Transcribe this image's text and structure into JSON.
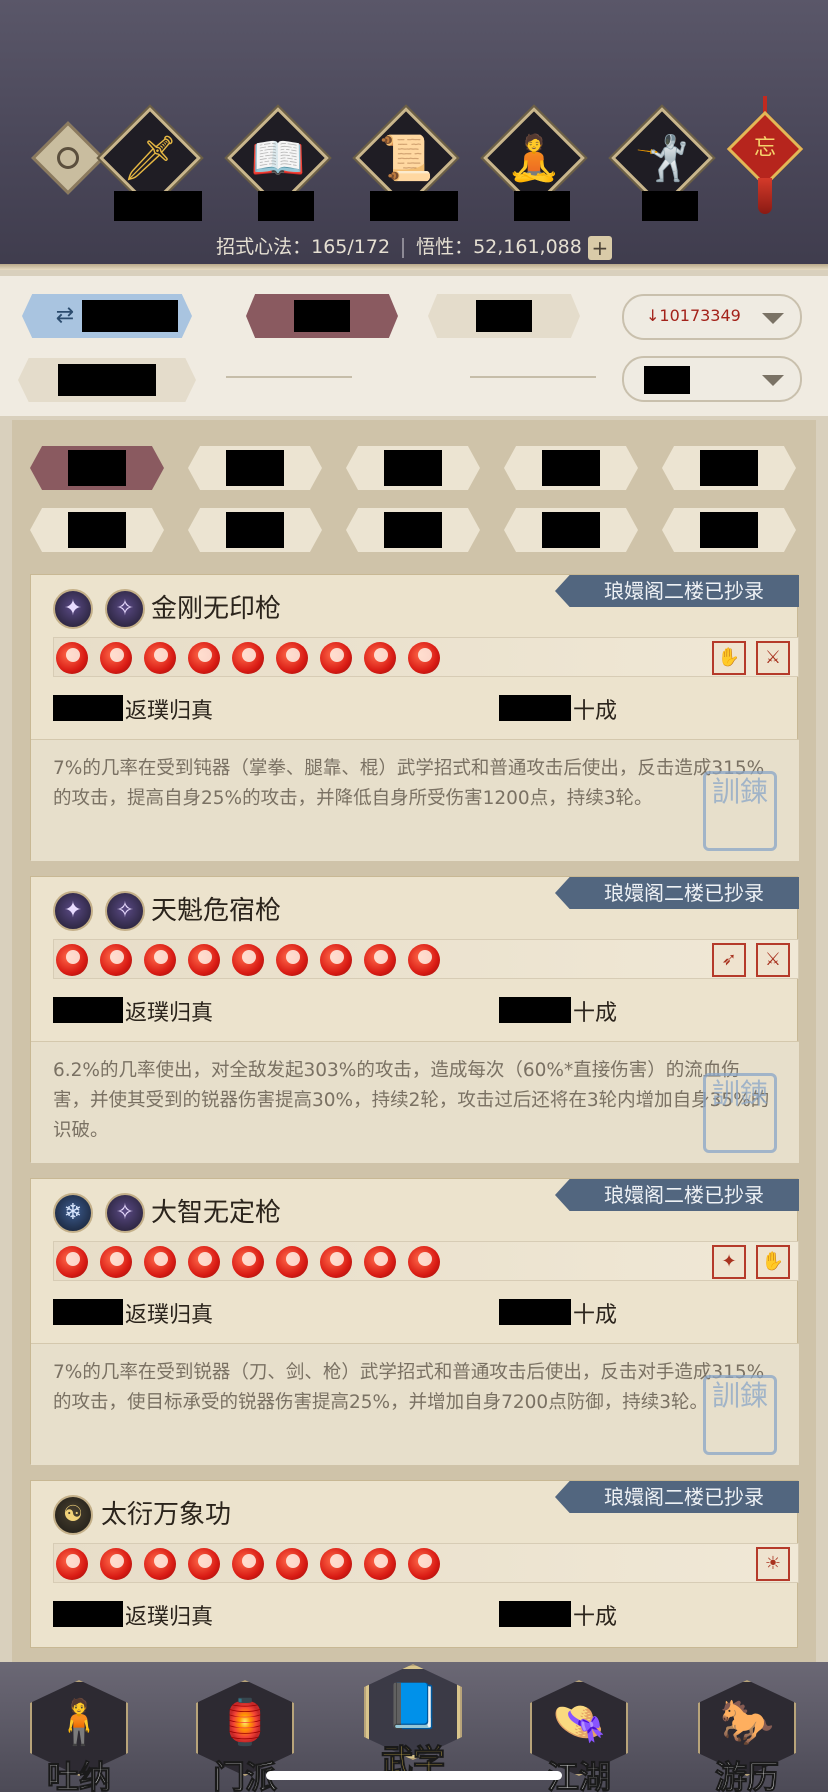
{
  "header": {
    "stats_label": "招式心法：165/172",
    "comprehension_label": "悟性：52,161,088",
    "plus_label": "+",
    "charm_char": "忘",
    "categories": [
      {
        "icon": "sword-icon",
        "glyph": "🗡"
      },
      {
        "icon": "book-icon",
        "glyph": "📖"
      },
      {
        "icon": "scroll-icon",
        "glyph": "📜"
      },
      {
        "icon": "meditation-icon",
        "glyph": "🧘"
      },
      {
        "icon": "martial-stance-icon",
        "glyph": "🤺"
      }
    ]
  },
  "filters": {
    "swap_glyph": "⇄",
    "sort_value": "10173349",
    "sort_prefix": "↓"
  },
  "skills": [
    {
      "banner": "琅嬛阁二楼已抄录",
      "title": "金刚无印枪",
      "orbs": [
        "✦",
        "✧"
      ],
      "flames": 9,
      "badges": [
        "✋",
        "⚔"
      ],
      "level_text": "返璞归真",
      "grade_text": "十成",
      "desc": "7%的几率在受到钝器（掌拳、腿靠、棍）武学招式和普通攻击后使出，反击造成315%的攻击，提高自身25%的攻击，并降低自身所受伤害1200点，持续3轮。"
    },
    {
      "banner": "琅嬛阁二楼已抄录",
      "title": "天魁危宿枪",
      "orbs": [
        "✦",
        "✧"
      ],
      "flames": 9,
      "badges": [
        "➶",
        "⚔"
      ],
      "level_text": "返璞归真",
      "grade_text": "十成",
      "desc": "6.2%的几率使出，对全敌发起303%的攻击，造成每次（60%*直接伤害）的流血伤害，并使其受到的锐器伤害提高30%，持续2轮，攻击过后还将在3轮内增加自身35%的识破。"
    },
    {
      "banner": "琅嬛阁二楼已抄录",
      "title": "大智无定枪",
      "orbs": [
        "❄",
        "✧"
      ],
      "flames": 9,
      "badges": [
        "✦",
        "✋"
      ],
      "level_text": "返璞归真",
      "grade_text": "十成",
      "desc": "7%的几率在受到锐器（刀、剑、枪）武学招式和普通攻击后使出，反击对手造成315%的攻击，使目标承受的锐器伤害提高25%，并增加自身7200点防御，持续3轮。"
    },
    {
      "banner": "琅嬛阁二楼已抄录",
      "title": "太衍万象功",
      "orbs": [
        "☯"
      ],
      "flames": 9,
      "badges": [
        "☀"
      ],
      "level_text": "返璞归真",
      "grade_text": "十成"
    }
  ],
  "seal_text": "訓鍊",
  "nav": [
    {
      "label": "吐纳",
      "icon": "meditating-figure-icon",
      "glyph": "🧍",
      "active": false
    },
    {
      "label": "门派",
      "icon": "sect-banners-icon",
      "glyph": "🏮",
      "active": false
    },
    {
      "label": "武学",
      "icon": "martial-book-icon",
      "glyph": "📘",
      "active": true
    },
    {
      "label": "江湖",
      "icon": "straw-hat-icon",
      "glyph": "👒",
      "active": false
    },
    {
      "label": "游历",
      "icon": "horse-icon",
      "glyph": "🐎",
      "active": false
    }
  ]
}
